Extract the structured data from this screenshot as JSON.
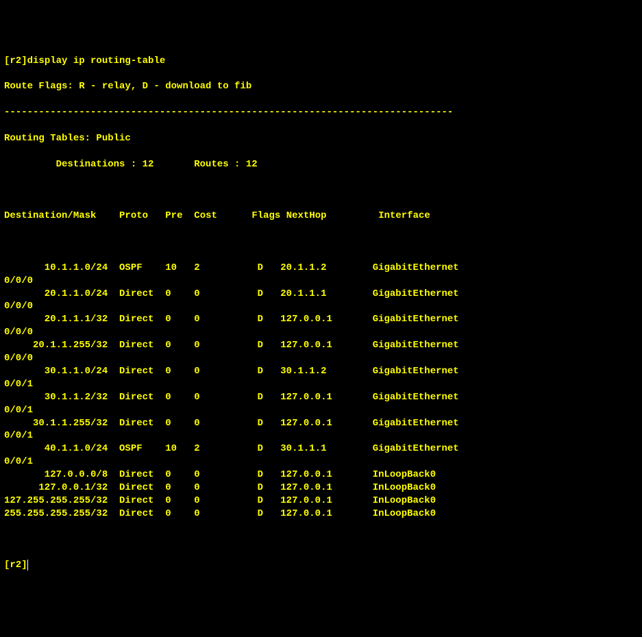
{
  "prompt_host": "[r2]",
  "command": "display ip routing-table",
  "flags_legend": "Route Flags: R - relay, D - download to fib",
  "divider": "------------------------------------------------------------------------------",
  "tables_title": "Routing Tables: Public",
  "summary": "         Destinations : 12       Routes : 12",
  "headers": {
    "dest": "Destination/Mask",
    "proto": "Proto",
    "pre": "Pre",
    "cost": "Cost",
    "flags": "Flags",
    "nexthop": "NextHop",
    "iface": "Interface"
  },
  "rows": [
    {
      "dest": "10.1.1.0/24",
      "proto": "OSPF",
      "pre": "10",
      "cost": "2",
      "flags": "D",
      "nexthop": "20.1.1.2",
      "iface": "GigabitEthernet",
      "iface2": "0/0/0"
    },
    {
      "dest": "20.1.1.0/24",
      "proto": "Direct",
      "pre": "0",
      "cost": "0",
      "flags": "D",
      "nexthop": "20.1.1.1",
      "iface": "GigabitEthernet",
      "iface2": "0/0/0"
    },
    {
      "dest": "20.1.1.1/32",
      "proto": "Direct",
      "pre": "0",
      "cost": "0",
      "flags": "D",
      "nexthop": "127.0.0.1",
      "iface": "GigabitEthernet",
      "iface2": "0/0/0"
    },
    {
      "dest": "20.1.1.255/32",
      "proto": "Direct",
      "pre": "0",
      "cost": "0",
      "flags": "D",
      "nexthop": "127.0.0.1",
      "iface": "GigabitEthernet",
      "iface2": "0/0/0"
    },
    {
      "dest": "30.1.1.0/24",
      "proto": "Direct",
      "pre": "0",
      "cost": "0",
      "flags": "D",
      "nexthop": "30.1.1.2",
      "iface": "GigabitEthernet",
      "iface2": "0/0/1"
    },
    {
      "dest": "30.1.1.2/32",
      "proto": "Direct",
      "pre": "0",
      "cost": "0",
      "flags": "D",
      "nexthop": "127.0.0.1",
      "iface": "GigabitEthernet",
      "iface2": "0/0/1"
    },
    {
      "dest": "30.1.1.255/32",
      "proto": "Direct",
      "pre": "0",
      "cost": "0",
      "flags": "D",
      "nexthop": "127.0.0.1",
      "iface": "GigabitEthernet",
      "iface2": "0/0/1"
    },
    {
      "dest": "40.1.1.0/24",
      "proto": "OSPF",
      "pre": "10",
      "cost": "2",
      "flags": "D",
      "nexthop": "30.1.1.1",
      "iface": "GigabitEthernet",
      "iface2": "0/0/1"
    },
    {
      "dest": "127.0.0.0/8",
      "proto": "Direct",
      "pre": "0",
      "cost": "0",
      "flags": "D",
      "nexthop": "127.0.0.1",
      "iface": "InLoopBack0",
      "iface2": ""
    },
    {
      "dest": "127.0.0.1/32",
      "proto": "Direct",
      "pre": "0",
      "cost": "0",
      "flags": "D",
      "nexthop": "127.0.0.1",
      "iface": "InLoopBack0",
      "iface2": ""
    },
    {
      "dest": "127.255.255.255/32",
      "proto": "Direct",
      "pre": "0",
      "cost": "0",
      "flags": "D",
      "nexthop": "127.0.0.1",
      "iface": "InLoopBack0",
      "iface2": ""
    },
    {
      "dest": "255.255.255.255/32",
      "proto": "Direct",
      "pre": "0",
      "cost": "0",
      "flags": "D",
      "nexthop": "127.0.0.1",
      "iface": "InLoopBack0",
      "iface2": ""
    }
  ],
  "final_prompt": "[r2]"
}
